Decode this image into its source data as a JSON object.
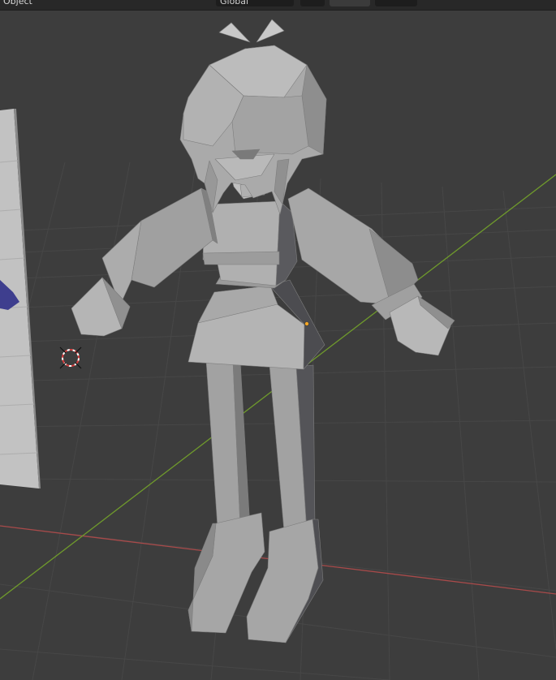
{
  "header": {
    "object_mode_label": "Object",
    "transform_orientation_label": "Global",
    "snap_icon": "snap-icon",
    "proportional_icon": "proportional-edit-icon",
    "overlay_icon": "overlay-icon"
  },
  "viewport": {
    "background": "#3d3d3d",
    "grid_color": "#4a4a4a",
    "x_axis_color": "#a84a4a",
    "y_axis_color": "#6f9a2c",
    "model_color": "#a5a5a5",
    "selection_origin_color": "#f5a623",
    "cursor_icon": "3d-cursor-icon"
  }
}
